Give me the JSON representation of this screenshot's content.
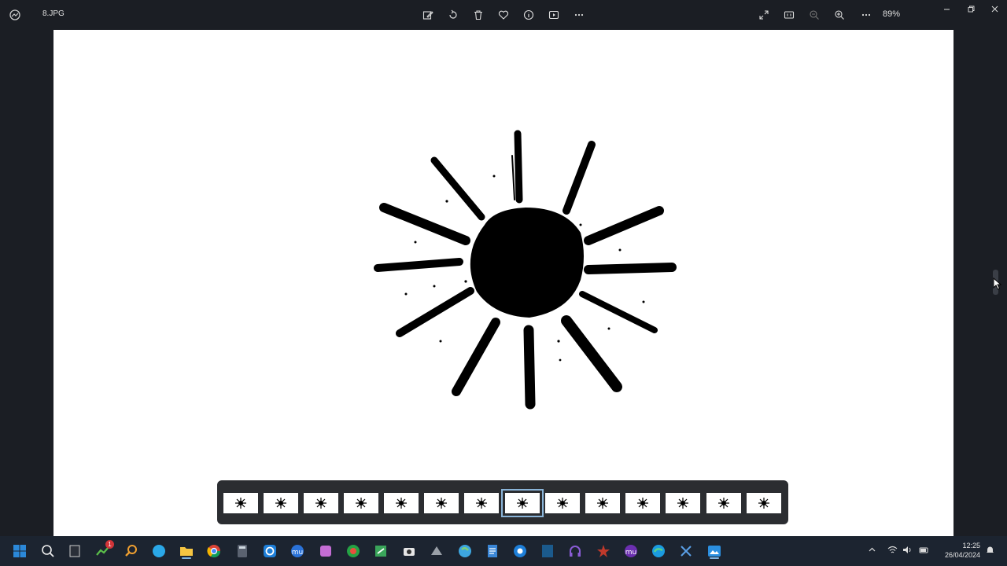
{
  "window": {
    "title": "8.JPG",
    "zoom": "89%"
  },
  "toolbar": {
    "items": [
      "edit-image",
      "rotate",
      "delete",
      "favorite",
      "file-info",
      "slideshow",
      "more"
    ],
    "right_items": [
      "full-screen",
      "actual-size",
      "zoom-out",
      "zoom-in",
      "more"
    ]
  },
  "filmstrip": {
    "count": 14,
    "selected_index": 7
  },
  "taskbar": {
    "notification_badge": "1",
    "time": "12:25",
    "date": "26/04/2024"
  },
  "colors": {
    "background": "#1b1e24",
    "taskbar": "#1c2430",
    "filmstrip": "#2b2d31",
    "selection": "#8ab4d8",
    "windows_blue": "#0078d4"
  }
}
